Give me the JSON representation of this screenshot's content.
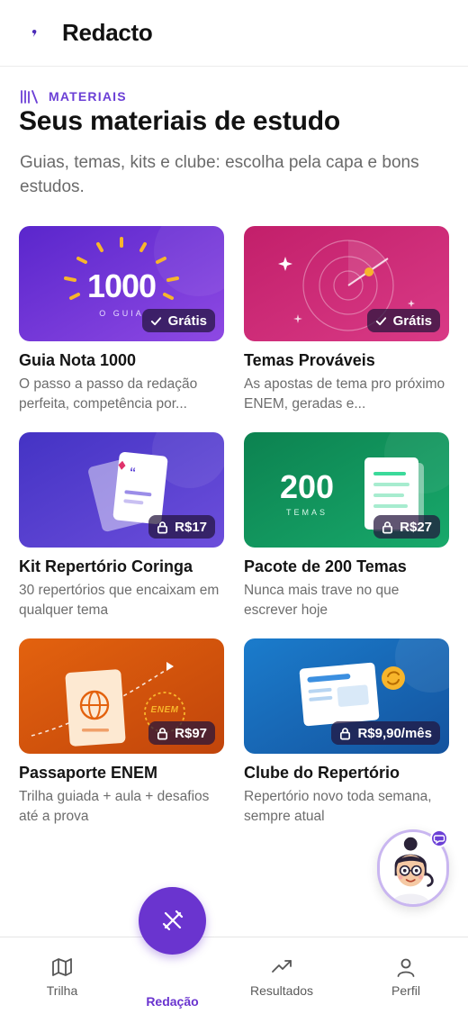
{
  "header": {
    "app_title": "Redacto"
  },
  "section": {
    "eyebrow": "MATERIAIS",
    "title": "Seus materiais de estudo",
    "subtitle": "Guias, temas, kits e clube: escolha pela capa e bons estudos."
  },
  "cards": [
    {
      "title": "Guia Nota 1000",
      "desc": "O passo a passo da redação perfeita, competência por...",
      "badge": "Grátis",
      "badge_icon": "check-icon",
      "cover_text": "1000",
      "cover_subtext": "O GUIA",
      "colors": [
        "#5d2bd0",
        "#8b46e0"
      ]
    },
    {
      "title": "Temas Prováveis",
      "desc": "As apostas de tema pro próximo ENEM, geradas e...",
      "badge": "Grátis",
      "badge_icon": "check-icon",
      "colors": [
        "#c8246f",
        "#d6337f"
      ]
    },
    {
      "title": "Kit Repertório Coringa",
      "desc": "30 repertórios que encaixam em qualquer tema",
      "badge": "R$17",
      "badge_icon": "lock-icon",
      "colors": [
        "#4a36c7",
        "#6a4ad9"
      ]
    },
    {
      "title": "Pacote de 200 Temas",
      "desc": "Nunca mais trave no que escrever hoje",
      "badge": "R$27",
      "badge_icon": "lock-icon",
      "cover_text": "200",
      "cover_subtext": "TEMAS",
      "colors": [
        "#0f8a55",
        "#16a266"
      ]
    },
    {
      "title": "Passaporte ENEM",
      "desc": "Trilha guiada + aula + desafios até a prova",
      "badge": "R$97",
      "badge_icon": "lock-icon",
      "cover_subtext": "ENEM",
      "colors": [
        "#e4600f",
        "#c8480b"
      ]
    },
    {
      "title": "Clube do Repertório",
      "desc": "Repertório novo toda semana, sempre atual",
      "badge": "R$9,90/mês",
      "badge_icon": "lock-icon",
      "colors": [
        "#1d77c9",
        "#1559a8"
      ]
    }
  ],
  "bottom_nav": {
    "items": [
      {
        "label": "Trilha",
        "icon": "map-icon"
      },
      {
        "label": "Redação",
        "icon": "pen-icon",
        "active": true
      },
      {
        "label": "Resultados",
        "icon": "trending-up-icon"
      },
      {
        "label": "Perfil",
        "icon": "user-icon"
      }
    ]
  },
  "accent_color": "#6a34cf"
}
